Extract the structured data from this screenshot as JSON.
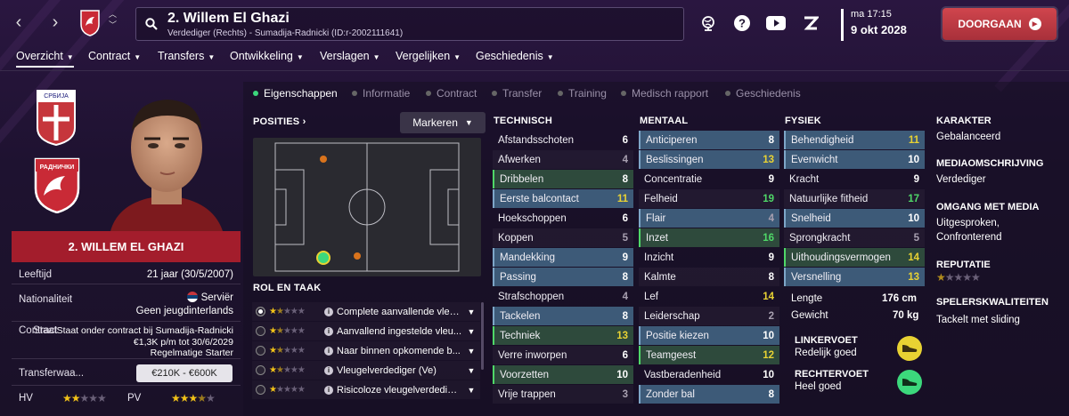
{
  "header": {
    "player_title": "2. Willem El Ghazi",
    "player_sub": "Verdediger (Rechts) - Sumadija-Radnicki (ID:r-2002111641)",
    "time": "ma 17:15",
    "date": "9 okt 2028",
    "continue_label": "DOORGAAN",
    "icons": [
      "back-icon",
      "forward-icon",
      "club-badge-icon",
      "updown-icon",
      "search-icon",
      "globe-icon",
      "help-icon",
      "youtube-icon",
      "z-icon"
    ]
  },
  "menu": [
    {
      "label": "Overzicht",
      "active": true
    },
    {
      "label": "Contract"
    },
    {
      "label": "Transfers"
    },
    {
      "label": "Ontwikkeling"
    },
    {
      "label": "Verslagen"
    },
    {
      "label": "Vergelijken"
    },
    {
      "label": "Geschiedenis"
    }
  ],
  "tabs": [
    "Eigenschappen",
    "Informatie",
    "Contract",
    "Transfer",
    "Training",
    "Medisch rapport",
    "Geschiedenis"
  ],
  "left": {
    "name_bar": "2. WILLEM EL GHAZI",
    "badge_top_text": "СРБИЈА",
    "badge_club_text": "РАДНИЧКИ",
    "age_label": "Leeftijd",
    "age_value": "21 jaar (30/5/2007)",
    "nat_label": "Nationaliteit",
    "nat_value": "Serviër",
    "nat_sub": "Geen jeugdinterlands",
    "contract_label": "Contract",
    "contract_overlap": "Staat",
    "contract_l1": "Staat onder contract bij Sumadija-Radnicki",
    "contract_l2": "€1,3K p/m tot 30/6/2029",
    "contract_l3": "Regelmatige Starter",
    "transfer_label": "Transferwaa...",
    "transfer_value": "€210K - €600K",
    "hv_label": "HV",
    "hv_stars": 2,
    "pv_label": "PV",
    "pv_stars": 3.5
  },
  "positions": {
    "label": "POSITIES",
    "markeren": "Markeren",
    "role_title": "ROL EN TAAK",
    "roles": [
      {
        "name": "Complete aanvallende vleu...",
        "stars": 1.5,
        "selected": true
      },
      {
        "name": "Aanvallend ingestelde vleu...",
        "stars": 1.5
      },
      {
        "name": "Naar binnen opkomende b...",
        "stars": 1.5
      },
      {
        "name": "Vleugelverdediger (Ve)",
        "stars": 1.5
      },
      {
        "name": "Risicoloze vleugelverdedige...",
        "stars": 1
      }
    ]
  },
  "technisch": {
    "title": "TECHNISCH",
    "attrs": [
      {
        "n": "Afstandsschoten",
        "v": "6",
        "c": "white",
        "hl": false
      },
      {
        "n": "Afwerken",
        "v": "4",
        "c": "grey",
        "hl": false
      },
      {
        "n": "Dribbelen",
        "v": "8",
        "c": "white",
        "hl": "green"
      },
      {
        "n": "Eerste balcontact",
        "v": "11",
        "c": "yellow",
        "hl": true
      },
      {
        "n": "Hoekschoppen",
        "v": "6",
        "c": "white",
        "hl": false
      },
      {
        "n": "Koppen",
        "v": "5",
        "c": "grey",
        "hl": false
      },
      {
        "n": "Mandekking",
        "v": "9",
        "c": "white",
        "hl": true
      },
      {
        "n": "Passing",
        "v": "8",
        "c": "white",
        "hl": true
      },
      {
        "n": "Strafschoppen",
        "v": "4",
        "c": "grey",
        "hl": false
      },
      {
        "n": "Tackelen",
        "v": "8",
        "c": "white",
        "hl": true
      },
      {
        "n": "Techniek",
        "v": "13",
        "c": "yellow",
        "hl": "green"
      },
      {
        "n": "Verre inworpen",
        "v": "6",
        "c": "white",
        "hl": false
      },
      {
        "n": "Voorzetten",
        "v": "10",
        "c": "white",
        "hl": "green"
      },
      {
        "n": "Vrije trappen",
        "v": "3",
        "c": "grey",
        "hl": false
      }
    ]
  },
  "mentaal": {
    "title": "MENTAAL",
    "attrs": [
      {
        "n": "Anticiperen",
        "v": "8",
        "c": "white",
        "hl": true
      },
      {
        "n": "Beslissingen",
        "v": "13",
        "c": "yellow",
        "hl": true
      },
      {
        "n": "Concentratie",
        "v": "9",
        "c": "white",
        "hl": false
      },
      {
        "n": "Felheid",
        "v": "19",
        "c": "green",
        "hl": false
      },
      {
        "n": "Flair",
        "v": "4",
        "c": "grey",
        "hl": true
      },
      {
        "n": "Inzet",
        "v": "16",
        "c": "green",
        "hl": "green"
      },
      {
        "n": "Inzicht",
        "v": "9",
        "c": "white",
        "hl": false
      },
      {
        "n": "Kalmte",
        "v": "8",
        "c": "white",
        "hl": false
      },
      {
        "n": "Lef",
        "v": "14",
        "c": "yellow",
        "hl": false
      },
      {
        "n": "Leiderschap",
        "v": "2",
        "c": "grey",
        "hl": false
      },
      {
        "n": "Positie kiezen",
        "v": "10",
        "c": "white",
        "hl": true
      },
      {
        "n": "Teamgeest",
        "v": "12",
        "c": "yellow",
        "hl": "green"
      },
      {
        "n": "Vastberadenheid",
        "v": "10",
        "c": "white",
        "hl": false
      },
      {
        "n": "Zonder bal",
        "v": "8",
        "c": "white",
        "hl": true
      }
    ]
  },
  "fysiek": {
    "title": "FYSIEK",
    "attrs": [
      {
        "n": "Behendigheid",
        "v": "11",
        "c": "yellow",
        "hl": true
      },
      {
        "n": "Evenwicht",
        "v": "10",
        "c": "white",
        "hl": true
      },
      {
        "n": "Kracht",
        "v": "9",
        "c": "white",
        "hl": false
      },
      {
        "n": "Natuurlijke fitheid",
        "v": "17",
        "c": "green",
        "hl": false
      },
      {
        "n": "Snelheid",
        "v": "10",
        "c": "white",
        "hl": true
      },
      {
        "n": "Sprongkracht",
        "v": "5",
        "c": "grey",
        "hl": false
      },
      {
        "n": "Uithoudingsvermogen",
        "v": "14",
        "c": "yellow",
        "hl": "green"
      },
      {
        "n": "Versnelling",
        "v": "13",
        "c": "yellow",
        "hl": true
      }
    ],
    "height_label": "Lengte",
    "height_value": "176 cm",
    "weight_label": "Gewicht",
    "weight_value": "70 kg",
    "left_foot_label": "LINKERVOET",
    "left_foot_value": "Redelijk goed",
    "right_foot_label": "RECHTERVOET",
    "right_foot_value": "Heel goed"
  },
  "side": {
    "karakter_h": "KARAKTER",
    "karakter_v": "Gebalanceerd",
    "media_h": "MEDIAOMSCHRIJVING",
    "media_v": "Verdediger",
    "omgang_h": "OMGANG MET MEDIA",
    "omgang_v1": "Uitgesproken,",
    "omgang_v2": "Confronterend",
    "rep_h": "REPUTATIE",
    "rep_stars": 0.5,
    "skills_h": "SPELERSKWALITEITEN",
    "skills_v": "Tackelt met sliding"
  },
  "colors": {
    "accent": "#a31d2c",
    "continue": "#c23c45",
    "highlight": "#3d5a78",
    "green": "#4fd868",
    "yellow": "#e8d233"
  }
}
